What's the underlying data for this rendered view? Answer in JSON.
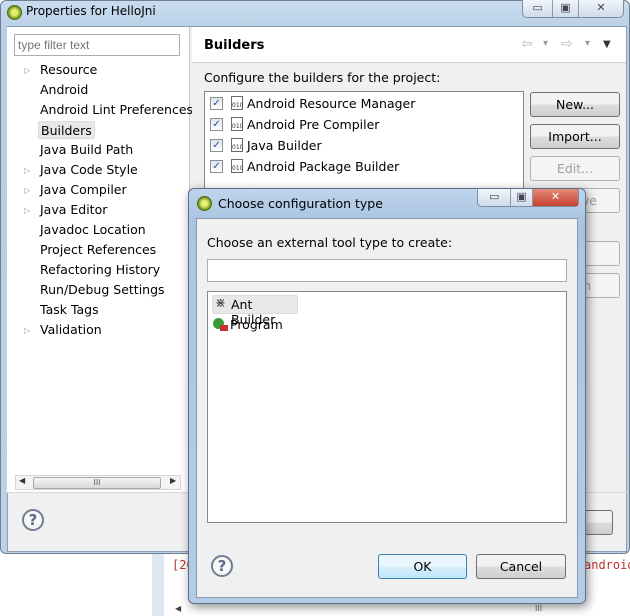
{
  "window": {
    "title": "Properties for HelloJni",
    "min_icon": "minimize-icon",
    "max_icon": "maximize-icon",
    "close_icon": "close-icon"
  },
  "sidebar": {
    "filter_placeholder": "type filter text",
    "items": [
      {
        "label": "Resource",
        "expandable": true
      },
      {
        "label": "Android",
        "expandable": false
      },
      {
        "label": "Android Lint Preferences",
        "expandable": false
      },
      {
        "label": "Builders",
        "expandable": false,
        "selected": true
      },
      {
        "label": "Java Build Path",
        "expandable": false
      },
      {
        "label": "Java Code Style",
        "expandable": true
      },
      {
        "label": "Java Compiler",
        "expandable": true
      },
      {
        "label": "Java Editor",
        "expandable": true
      },
      {
        "label": "Javadoc Location",
        "expandable": false
      },
      {
        "label": "Project References",
        "expandable": false
      },
      {
        "label": "Refactoring History",
        "expandable": false
      },
      {
        "label": "Run/Debug Settings",
        "expandable": false
      },
      {
        "label": "Task Tags",
        "expandable": false
      },
      {
        "label": "Validation",
        "expandable": true
      }
    ],
    "scroll_grip": "III"
  },
  "main": {
    "title": "Builders",
    "description": "Configure the builders for the project:",
    "builders": [
      {
        "label": "Android Resource Manager",
        "checked": true
      },
      {
        "label": "Android Pre Compiler",
        "checked": true
      },
      {
        "label": "Java Builder",
        "checked": true
      },
      {
        "label": "Android Package Builder",
        "checked": true
      }
    ],
    "buttons": {
      "new": "New...",
      "import": "Import...",
      "edit": "Edit...",
      "remove_fragment": "ve",
      "hidden_fragment": "n"
    },
    "nav": {
      "back": "⇦",
      "forward": "⇨",
      "dropdown": "▾",
      "menu": "▼"
    }
  },
  "console": {
    "left_fragment": "[20",
    "right_fragment": "android",
    "scroll_grip": "III"
  },
  "dialog": {
    "title": "Choose configuration type",
    "prompt": "Choose an external tool type to create:",
    "filter_value": "",
    "types": [
      {
        "label": "Ant Builder",
        "icon": "ant-icon",
        "selected": true
      },
      {
        "label": "Program",
        "icon": "program-icon"
      }
    ],
    "ok": "OK",
    "cancel": "Cancel"
  },
  "colors": {
    "close_button": "#c8402e",
    "error_text": "#c03030",
    "title_bar": "#b9cfe6"
  }
}
